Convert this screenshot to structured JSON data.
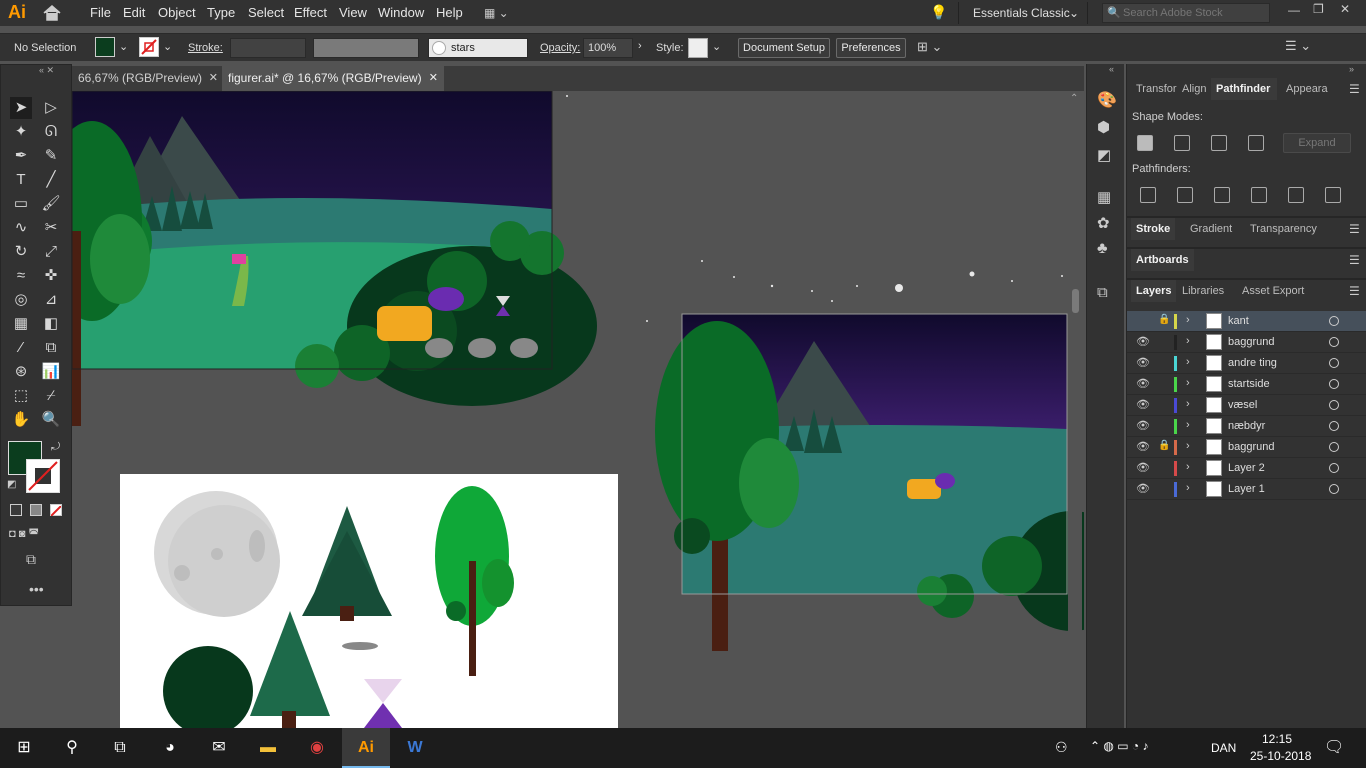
{
  "app": {
    "logo": "Ai",
    "workspace": "Essentials Classic",
    "search_placeholder": "Search Adobe Stock"
  },
  "menu": [
    "File",
    "Edit",
    "Object",
    "Type",
    "Select",
    "Effect",
    "View",
    "Window",
    "Help"
  ],
  "control": {
    "selection": "No Selection",
    "stroke_label": "Stroke:",
    "brush_name": "stars",
    "opacity_label": "Opacity:",
    "opacity_value": "100%",
    "style_label": "Style:",
    "document_setup": "Document Setup",
    "preferences": "Preferences"
  },
  "tabs": [
    {
      "label": "66,67% (RGB/Preview)",
      "active": false
    },
    {
      "label": "figurer.ai* @ 16,67% (RGB/Preview)",
      "active": true
    }
  ],
  "panels": {
    "top_tabs": [
      "Transfor",
      "Align",
      "Pathfinder",
      "Appeara"
    ],
    "shape_modes": "Shape Modes:",
    "expand": "Expand",
    "pathfinders": "Pathfinders:",
    "mid_tabs": [
      "Stroke",
      "Gradient",
      "Transparency"
    ],
    "artboards": "Artboards",
    "layer_tabs": [
      "Layers",
      "Libraries",
      "Asset Export"
    ]
  },
  "layers": [
    {
      "name": "kant",
      "color": "#d6d64a",
      "locked": true,
      "visible": false,
      "selected": true
    },
    {
      "name": "baggrund",
      "color": "#222222",
      "locked": false,
      "visible": true,
      "selected": false
    },
    {
      "name": "andre ting",
      "color": "#4ad6d6",
      "locked": false,
      "visible": true,
      "selected": false
    },
    {
      "name": "startside",
      "color": "#4ad64a",
      "locked": false,
      "visible": true,
      "selected": false
    },
    {
      "name": "væsel",
      "color": "#4a4ad6",
      "locked": false,
      "visible": true,
      "selected": false
    },
    {
      "name": "næbdyr",
      "color": "#4ad64a",
      "locked": false,
      "visible": true,
      "selected": false
    },
    {
      "name": "baggrund",
      "color": "#d66a4a",
      "locked": true,
      "visible": true,
      "selected": false
    },
    {
      "name": "Layer 2",
      "color": "#d64a4a",
      "locked": false,
      "visible": true,
      "selected": false
    },
    {
      "name": "Layer 1",
      "color": "#4a6ad6",
      "locked": false,
      "visible": true,
      "selected": false
    }
  ],
  "taskbar": {
    "time": "12:15",
    "date": "25-10-2018",
    "lang": "DAN"
  },
  "colors": {
    "accent": "#ff9a00",
    "fill": "#0b3d1e",
    "panel": "#323232",
    "canvas": "#535353"
  }
}
